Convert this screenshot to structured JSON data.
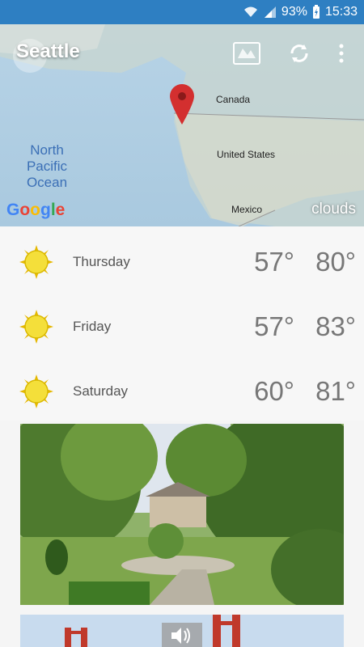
{
  "status_bar": {
    "battery": "93%",
    "time": "15:33"
  },
  "header": {
    "city": "Seattle"
  },
  "map": {
    "labels": {
      "canada": "Canada",
      "united_states": "United States",
      "mexico": "Mexico",
      "ocean_line1": "North",
      "ocean_line2": "Pacific",
      "ocean_line3": "Ocean"
    },
    "provider": "Google",
    "layer": "clouds"
  },
  "forecast": [
    {
      "day": "Thursday",
      "low": "57°",
      "high": "80°",
      "icon": "sun-icon"
    },
    {
      "day": "Friday",
      "low": "57°",
      "high": "83°",
      "icon": "sun-icon"
    },
    {
      "day": "Saturday",
      "low": "60°",
      "high": "81°",
      "icon": "sun-icon"
    }
  ],
  "colors": {
    "status_bar": "#2e7fc2",
    "pin": "#d32f2f",
    "sun": "#f4df3a"
  }
}
